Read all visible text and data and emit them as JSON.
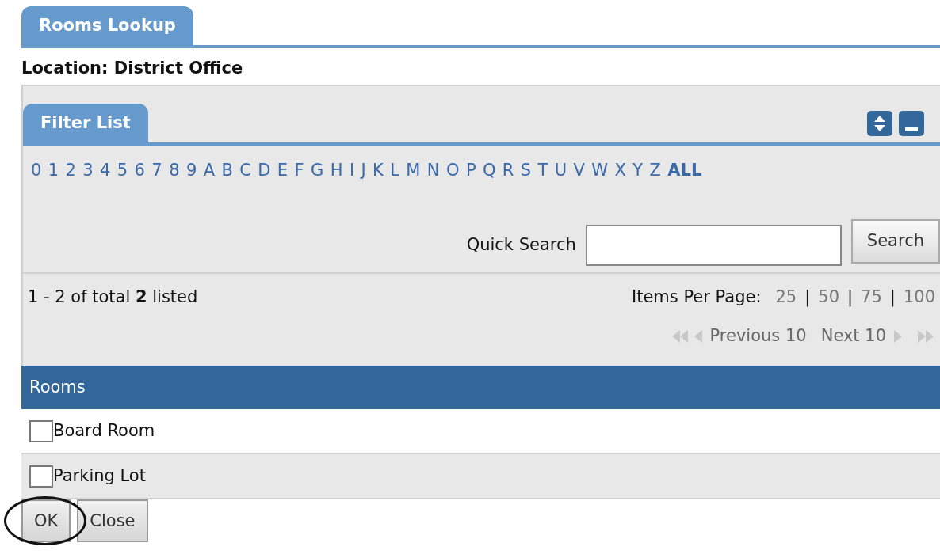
{
  "title_tab": {
    "label": "Rooms Lookup",
    "selected": true
  },
  "location": {
    "label": "Location:",
    "value": "District Office"
  },
  "filter": {
    "tab": {
      "label": "Filter List",
      "selected": true
    },
    "letters": [
      {
        "label": "0",
        "selected": false
      },
      {
        "label": "1",
        "selected": false
      },
      {
        "label": "2",
        "selected": false
      },
      {
        "label": "3",
        "selected": false
      },
      {
        "label": "4",
        "selected": false
      },
      {
        "label": "5",
        "selected": false
      },
      {
        "label": "6",
        "selected": false
      },
      {
        "label": "7",
        "selected": false
      },
      {
        "label": "8",
        "selected": false
      },
      {
        "label": "9",
        "selected": false
      },
      {
        "label": "A",
        "selected": false
      },
      {
        "label": "B",
        "selected": false
      },
      {
        "label": "C",
        "selected": false
      },
      {
        "label": "D",
        "selected": false
      },
      {
        "label": "E",
        "selected": false
      },
      {
        "label": "F",
        "selected": false
      },
      {
        "label": "G",
        "selected": false
      },
      {
        "label": "H",
        "selected": false
      },
      {
        "label": "I",
        "selected": false
      },
      {
        "label": "J",
        "selected": false
      },
      {
        "label": "K",
        "selected": false
      },
      {
        "label": "L",
        "selected": false
      },
      {
        "label": "M",
        "selected": false
      },
      {
        "label": "N",
        "selected": false
      },
      {
        "label": "O",
        "selected": false
      },
      {
        "label": "P",
        "selected": false
      },
      {
        "label": "Q",
        "selected": false
      },
      {
        "label": "R",
        "selected": false
      },
      {
        "label": "S",
        "selected": false
      },
      {
        "label": "T",
        "selected": false
      },
      {
        "label": "U",
        "selected": false
      },
      {
        "label": "V",
        "selected": false
      },
      {
        "label": "W",
        "selected": false
      },
      {
        "label": "X",
        "selected": false
      },
      {
        "label": "Y",
        "selected": false
      },
      {
        "label": "Z",
        "selected": false
      },
      {
        "label": "ALL",
        "selected": true
      }
    ],
    "quick_search": {
      "label": "Quick Search",
      "button": "Search"
    }
  },
  "listing": {
    "summary": "1 - 2 of total **2** listed",
    "items_per_page": {
      "label": "Items Per Page:",
      "options": [
        "25",
        "50",
        "75",
        "100"
      ],
      "separators": [
        "|",
        "|",
        "|"
      ]
    },
    "pager": {
      "previous": "Previous 10",
      "next": "Next 10",
      "nav_disabled": true
    }
  },
  "table": {
    "column": "Rooms",
    "rows": [
      {
        "label": "Board Room",
        "checked": false
      },
      {
        "label": "Parking Lot",
        "checked": false
      }
    ]
  },
  "buttons": [
    {
      "label": "OK",
      "circled": true
    },
    {
      "label": "Close",
      "circled": false
    }
  ]
}
